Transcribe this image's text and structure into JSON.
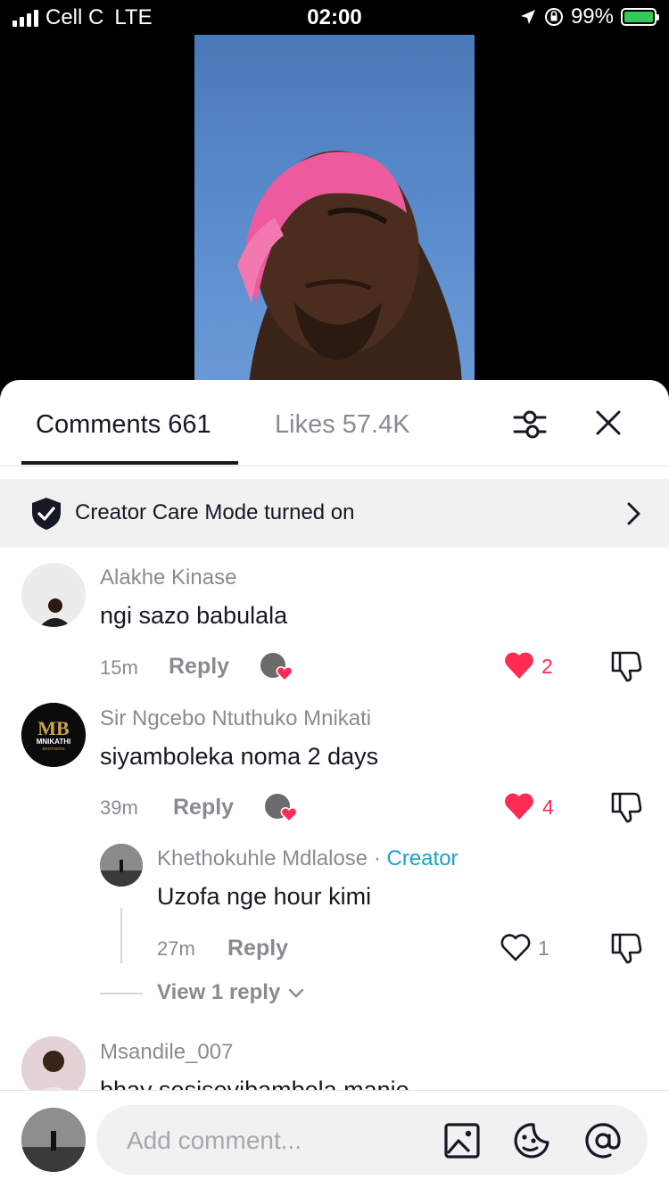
{
  "status_bar": {
    "carrier": "Cell C",
    "network": "LTE",
    "time": "02:00",
    "battery": "99%"
  },
  "tabs": {
    "comments_label": "Comments 661",
    "likes_label": "Likes 57.4K"
  },
  "creator_care": {
    "text": "Creator Care Mode turned on"
  },
  "comments": [
    {
      "username": "Alakhe Kinase",
      "text": "ngi sazo babulala",
      "time": "15m",
      "reply_label": "Reply",
      "likes": "2"
    },
    {
      "username": "Sir Ngcebo Ntuthuko Mnikati",
      "text": "siyamboleka noma 2 days",
      "time": "39m",
      "reply_label": "Reply",
      "likes": "4"
    }
  ],
  "reply": {
    "username": "Khethokuhle Mdlalose",
    "separator": "·",
    "badge": "Creator",
    "text": "Uzofa nge hour kimi",
    "time": "27m",
    "reply_label": "Reply",
    "likes": "1"
  },
  "view_replies": "View 1 reply",
  "comment3": {
    "username": "Msandile_007",
    "text": "bhay sesisevibambela manje"
  },
  "avatar_logo": {
    "initials": "MB",
    "name": "MNIKATHI",
    "sub": "BROTHERS"
  },
  "composer": {
    "placeholder": "Add comment..."
  },
  "colors": {
    "heart": "#fe2c55",
    "creator": "#17a3c8",
    "text": "#161823",
    "muted": "#8a8b91"
  }
}
